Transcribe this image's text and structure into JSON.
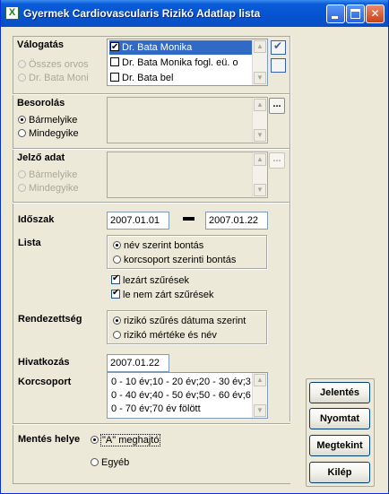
{
  "window": {
    "title": "Gyermek Cardiovascularis Rizikó Adatlap lista",
    "app_icon": "excel-icon",
    "minimize_icon": "minimize-icon",
    "maximize_icon": "maximize-icon",
    "close_icon": "close-icon",
    "close_glyph": "✕"
  },
  "valogatas": {
    "label": "Válogatás",
    "radio_all": "Összes orvos",
    "radio_doctor": "Dr. Bata Moni",
    "items": [
      {
        "label": "Dr. Bata Monika",
        "checked": true,
        "selected": true
      },
      {
        "label": "Dr. Bata Monika fogl. eü. o",
        "checked": false,
        "selected": false
      },
      {
        "label": "Dr. Bata bel",
        "checked": false,
        "selected": false
      }
    ],
    "check_all_icon": "check-all-icon",
    "uncheck_all_icon": "uncheck-all-icon"
  },
  "besorolas": {
    "label": "Besorolás",
    "options": [
      "Bármelyike",
      "Mindegyike"
    ],
    "selected": "Bármelyike",
    "dots": "..."
  },
  "jelzo": {
    "label": "Jelző adat",
    "options": [
      "Bármelyike",
      "Mindegyike"
    ],
    "dots": "..."
  },
  "idoszak": {
    "label": "Időszak",
    "from": "2007.01.01",
    "to": "2007.01.22"
  },
  "lista": {
    "label": "Lista",
    "options": [
      "név szerint bontás",
      "korcsoport szerinti bontás"
    ],
    "selected": "név szerint bontás",
    "checks": [
      {
        "label": "lezárt szűrések",
        "checked": true
      },
      {
        "label": "le nem zárt szűrések",
        "checked": true
      }
    ]
  },
  "rendezettseg": {
    "label": "Rendezettség",
    "options": [
      "rizikó szűrés dátuma szerint",
      "rizikó mértéke és név"
    ],
    "selected": "rizikó szűrés dátuma szerint"
  },
  "hivatkozas": {
    "label": "Hivatkozás",
    "value": "2007.01.22"
  },
  "korcsoport": {
    "label": "Korcsoport",
    "value": "0 - 10 év;10 - 20 év;20 - 30 év;30 - 40 év;40 - 50 év;50 - 60 év;60 - 70 év;70 év fölött"
  },
  "mentes": {
    "label": "Mentés helye",
    "options": [
      "\"A\" meghajtó",
      "Egyéb"
    ],
    "selected": "\"A\" meghajtó"
  },
  "buttons": {
    "jelentes": "Jelentés",
    "nyomtat": "Nyomtat",
    "megtekint": "Megtekint",
    "kilep": "Kilép"
  }
}
